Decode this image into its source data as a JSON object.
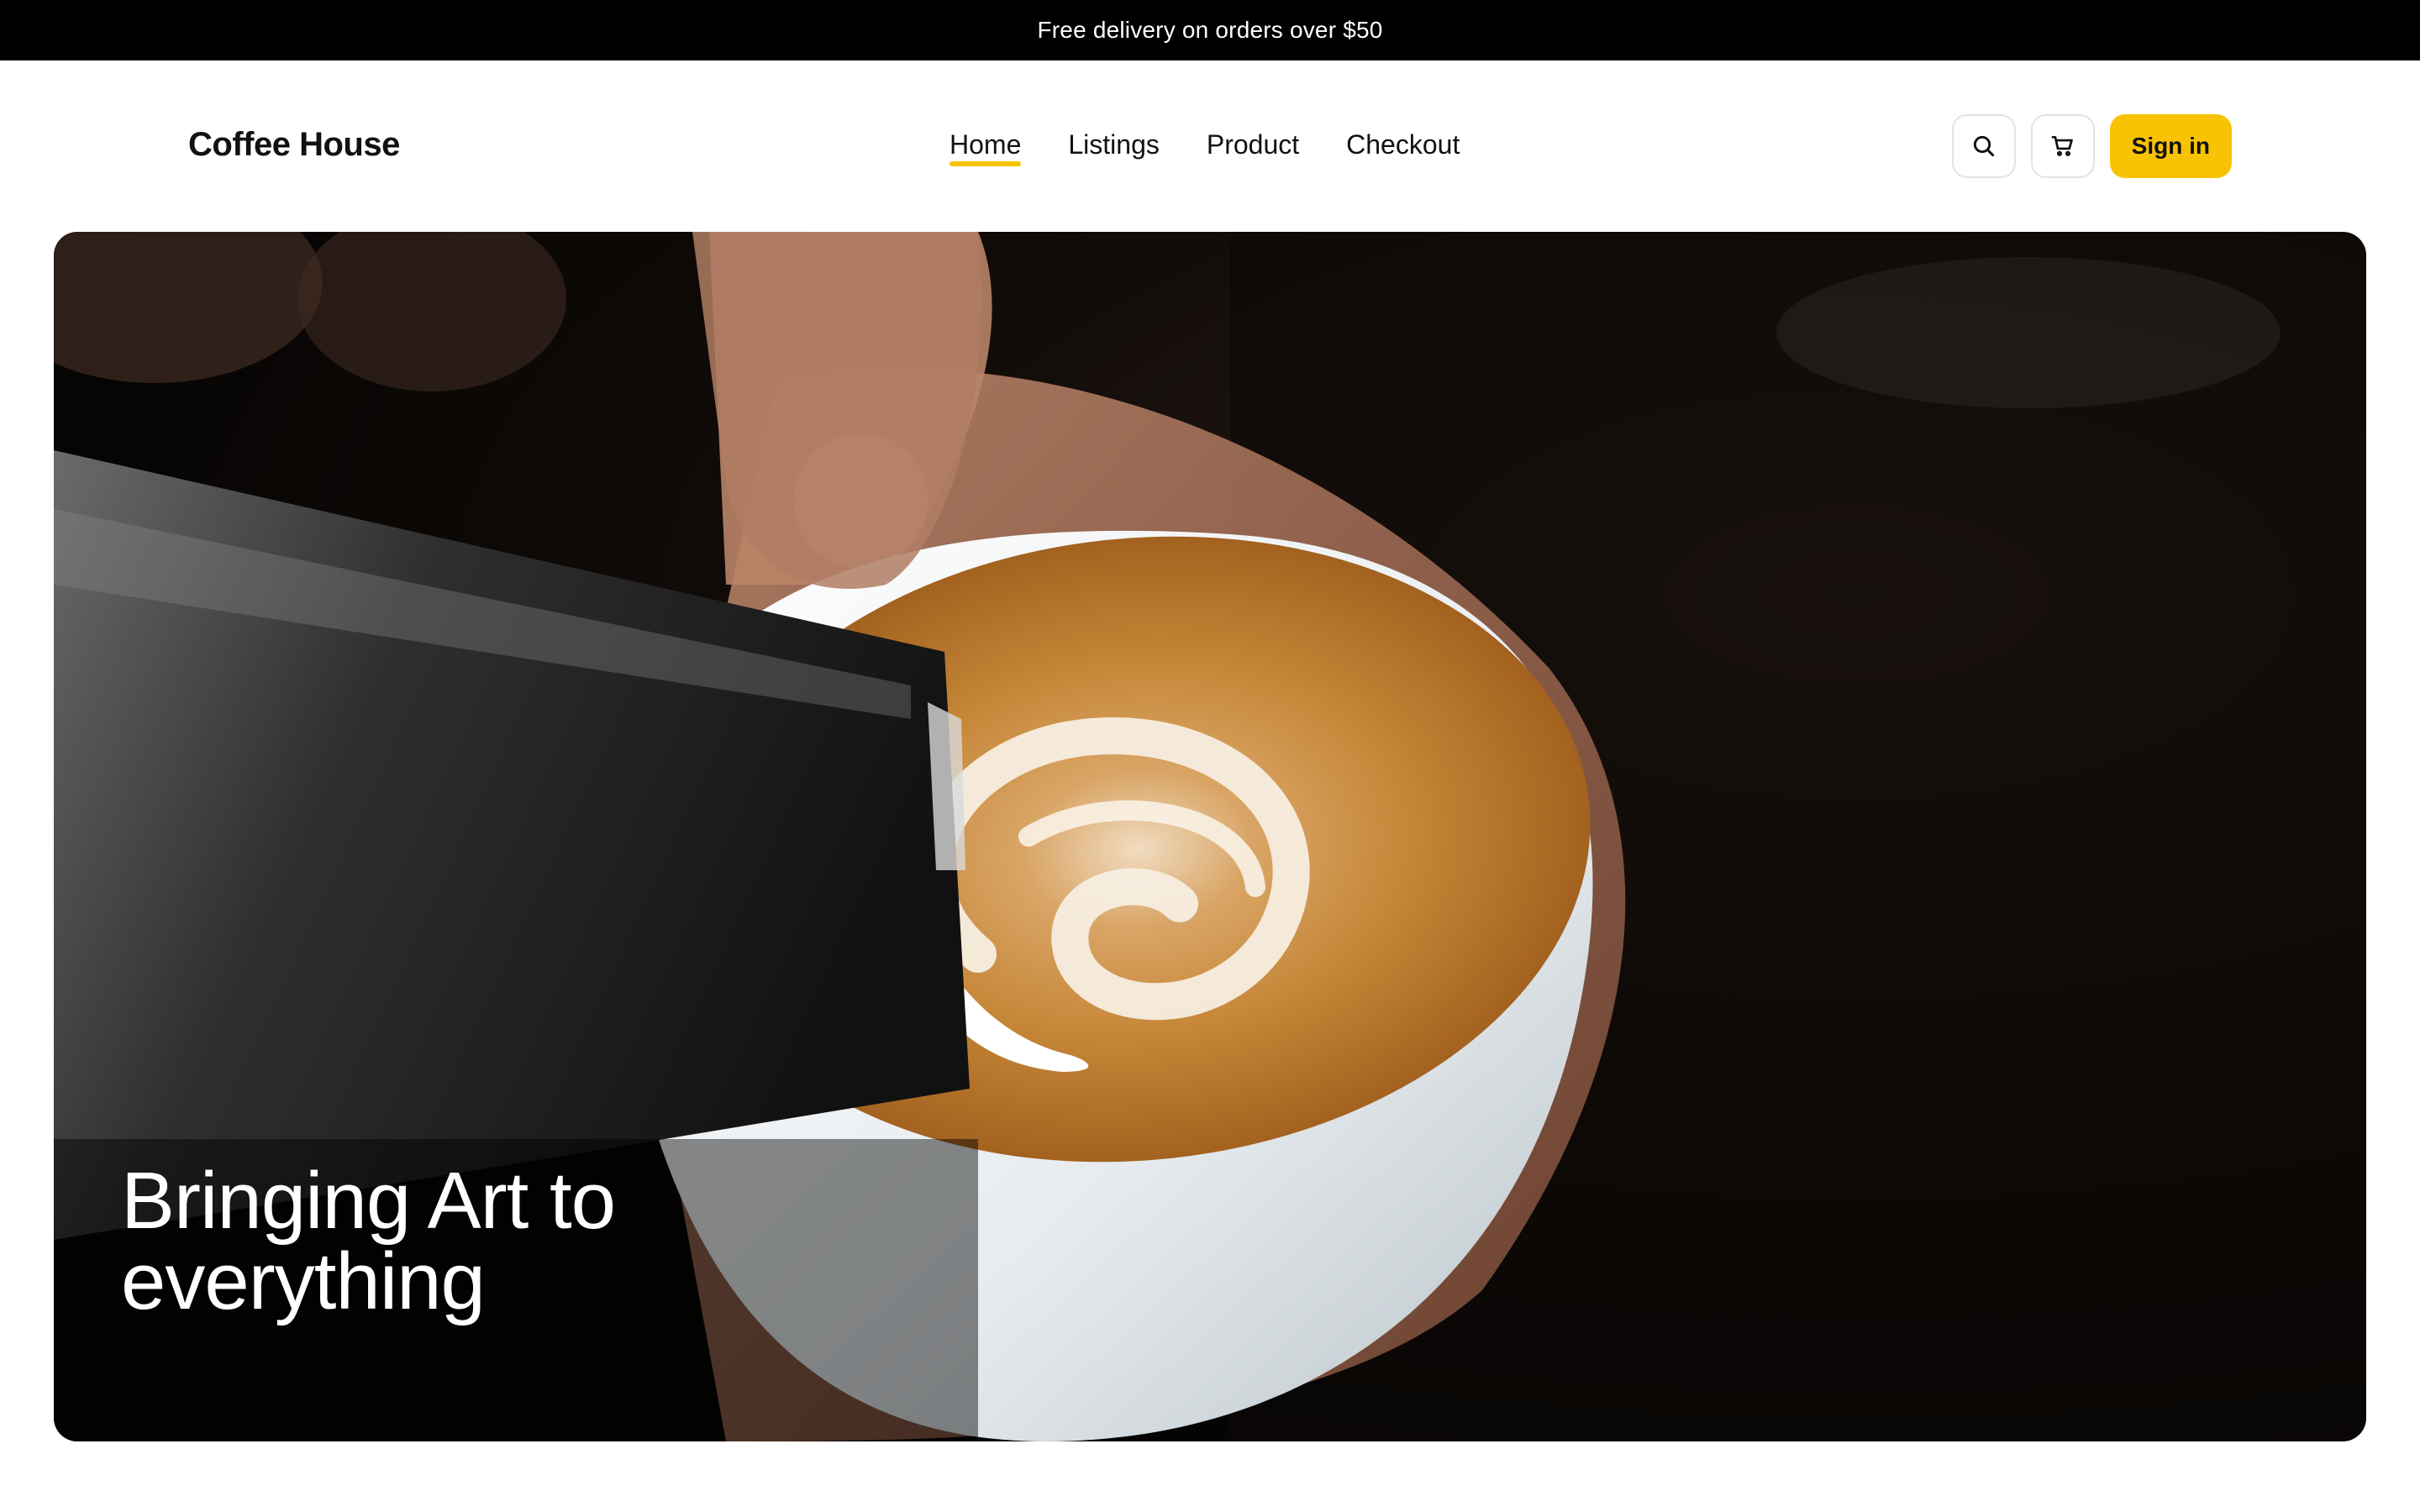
{
  "announcement": {
    "text": "Free delivery on orders over $50"
  },
  "header": {
    "brand": "Coffee House",
    "nav": [
      {
        "label": "Home",
        "active": true
      },
      {
        "label": "Listings",
        "active": false
      },
      {
        "label": "Product",
        "active": false
      },
      {
        "label": "Checkout",
        "active": false
      }
    ],
    "actions": {
      "search_icon": "search-icon",
      "cart_icon": "cart-icon",
      "signin_label": "Sign in"
    }
  },
  "hero": {
    "title": "Bringing Art to everything",
    "image": "latte-art-pour-photo"
  },
  "colors": {
    "accent": "#f8c304",
    "announcement_bg": "#000000",
    "text": "#111111"
  }
}
